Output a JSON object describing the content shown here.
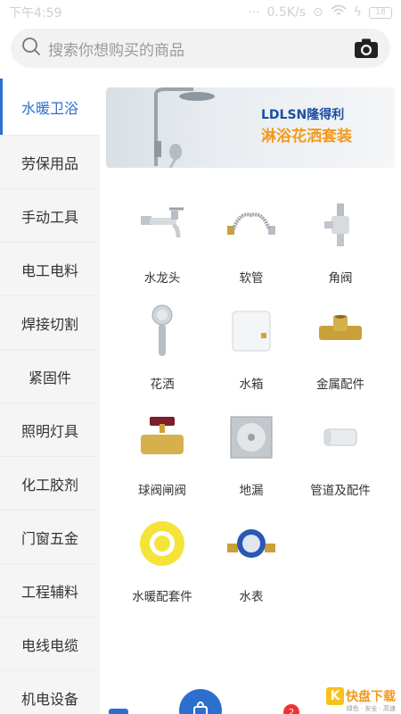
{
  "status_bar": {
    "time": "下午4:59",
    "speed": "0.5K/s",
    "battery": "18"
  },
  "search": {
    "placeholder": "搜索你想购买的商品",
    "icon": "search-icon",
    "camera_icon": "camera-icon"
  },
  "sidebar": {
    "active_color": "#2d6fcf",
    "items": [
      {
        "label": "水暖卫浴"
      },
      {
        "label": "劳保用品"
      },
      {
        "label": "手动工具"
      },
      {
        "label": "电工电料"
      },
      {
        "label": "焊接切割"
      },
      {
        "label": "紧固件"
      },
      {
        "label": "照明灯具"
      },
      {
        "label": "化工胶剂"
      },
      {
        "label": "门窗五金"
      },
      {
        "label": "工程辅料"
      },
      {
        "label": "电线电缆"
      },
      {
        "label": "机电设备"
      }
    ]
  },
  "banner": {
    "brand": "LDLSN隆得利",
    "title": "淋浴花洒套装"
  },
  "categories": [
    {
      "label": "水龙头",
      "icon": "faucet-icon"
    },
    {
      "label": "软管",
      "icon": "hose-icon"
    },
    {
      "label": "角阀",
      "icon": "angle-valve-icon"
    },
    {
      "label": "花洒",
      "icon": "shower-head-icon"
    },
    {
      "label": "水箱",
      "icon": "water-tank-icon"
    },
    {
      "label": "金属配件",
      "icon": "metal-fitting-icon"
    },
    {
      "label": "球阀闸阀",
      "icon": "ball-valve-icon"
    },
    {
      "label": "地漏",
      "icon": "floor-drain-icon"
    },
    {
      "label": "管道及配件",
      "icon": "pipe-fitting-icon"
    },
    {
      "label": "水暖配套件",
      "icon": "ptfe-tape-icon"
    },
    {
      "label": "水表",
      "icon": "water-meter-icon"
    }
  ],
  "bottom_nav": {
    "badge_count": "2"
  },
  "watermark": {
    "text": "快盘下载",
    "sub": "绿色 · 安全 · 高速"
  }
}
